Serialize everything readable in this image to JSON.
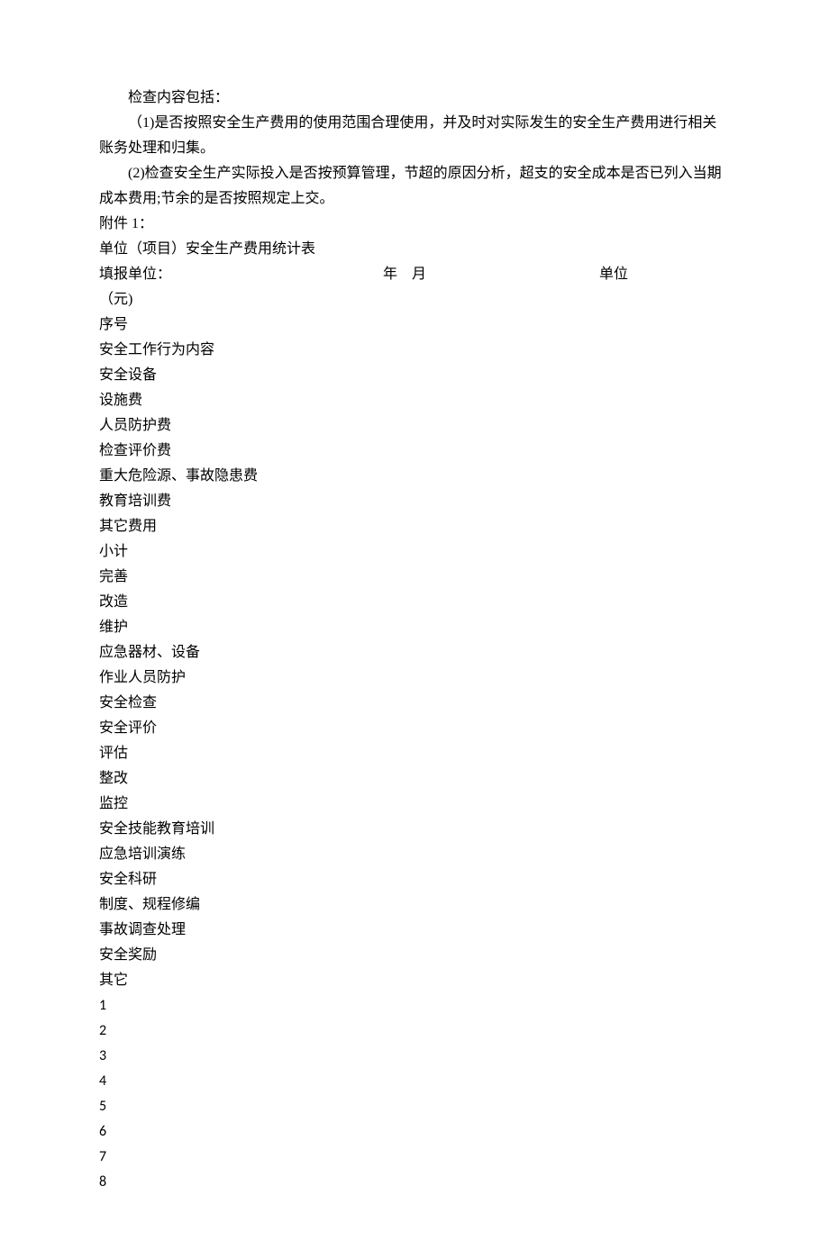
{
  "paragraphs": {
    "p1": "检查内容包括：",
    "p2": "（1)是否按照安全生产费用的使用范围合理使用，并及时对实际发生的安全生产费用进行相关账务处理和归集。",
    "p3": "(2)检查安全生产实际投入是否按预算管理，节超的原因分析，超支的安全成本是否已列入当期成本费用;节余的是否按照规定上交。"
  },
  "attachment_label": "附件 1：",
  "table_title": "单位（项目）安全生产费用统计表",
  "form": {
    "unit_label": "填报单位：",
    "year": "年",
    "month": "月",
    "unit": "单位",
    "yuan": "（元)"
  },
  "headers": [
    "序号",
    "安全工作行为内容",
    "安全设备",
    "设施费",
    "人员防护费",
    "检查评价费",
    "重大危险源、事故隐患费",
    "教育培训费",
    "其它费用",
    "小计",
    "完善",
    "改造",
    "维护",
    "应急器材、设备",
    "作业人员防护",
    "安全检查",
    "安全评价",
    "评估",
    "整改",
    "监控",
    "安全技能教育培训",
    "应急培训演练",
    "安全科研",
    "制度、规程修编",
    "事故调查处理",
    "安全奖励",
    "其它"
  ],
  "rows": [
    "1",
    "2",
    "3",
    "4",
    "5",
    "6",
    "7",
    "8"
  ]
}
